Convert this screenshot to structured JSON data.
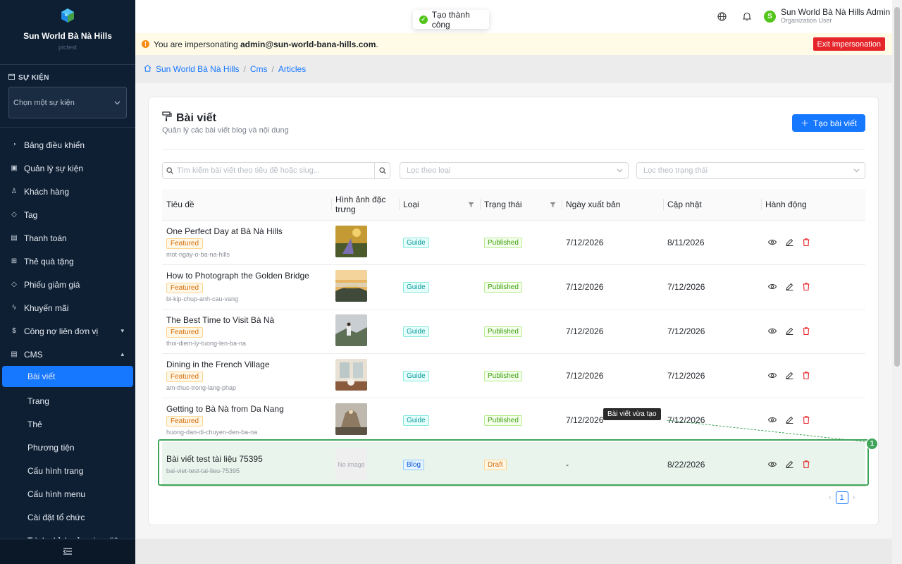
{
  "sidebar": {
    "brand_name": "Sun World Bà Nà Hills",
    "brand_sub": "pictest",
    "section_label": "SỰ KIỆN",
    "event_placeholder": "Chọn một sự kiện",
    "items": [
      {
        "label": "Bảng điều khiển",
        "icon": "dashboard-icon"
      },
      {
        "label": "Quản lý sự kiện",
        "icon": "calendar-icon"
      },
      {
        "label": "Khách hàng",
        "icon": "users-icon"
      },
      {
        "label": "Tag",
        "icon": "tag-icon"
      },
      {
        "label": "Thanh toán",
        "icon": "payment-icon"
      },
      {
        "label": "Thẻ quà tặng",
        "icon": "gift-icon"
      },
      {
        "label": "Phiếu giảm giá",
        "icon": "coupon-icon"
      },
      {
        "label": "Khuyến mãi",
        "icon": "promotion-icon"
      },
      {
        "label": "Công nợ liên đơn vị",
        "icon": "debt-icon"
      },
      {
        "label": "CMS",
        "icon": "cms-icon"
      }
    ],
    "cms_sub": [
      "Bài viết",
      "Trang",
      "Thẻ",
      "Phương tiện",
      "Cấu hình trang",
      "Cấu hình menu",
      "Cài đặt tổ chức",
      "Trình chỉnh sửa giao diện"
    ]
  },
  "toast": "Tạo thành công",
  "user": {
    "name": "Sun World Bà Nà Hills Admin",
    "role": "Organization User",
    "initial": "S"
  },
  "banner": {
    "prefix": "You are impersonating ",
    "email": "admin@sun-world-bana-hills.com",
    "suffix": ".",
    "exit_label": "Exit impersonation"
  },
  "breadcrumb": [
    "Sun World Bà Nà Hills",
    "Cms",
    "Articles"
  ],
  "page": {
    "title": "Bài viết",
    "subtitle": "Quản lý các bài viết blog và nội dung",
    "create_label": "Tạo bài viết",
    "search_placeholder": "Tìm kiếm bài viết theo tiêu đề hoặc slug...",
    "filter_type_placeholder": "Lọc theo loại",
    "filter_status_placeholder": "Lọc theo trạng thái"
  },
  "table": {
    "headers": [
      "Tiêu đề",
      "Hình ảnh đặc trưng",
      "Loại",
      "Trạng thái",
      "Ngày xuất bản",
      "Cập nhật",
      "Hành động"
    ],
    "rows": [
      {
        "title": "One Perfect Day at Bà Nà Hills",
        "featured": "Featured",
        "slug": "mot-ngay-o-ba-na-hills",
        "type": "Guide",
        "status": "Published",
        "published": "7/12/2026",
        "updated": "8/11/2026"
      },
      {
        "title": "How to Photograph the Golden Bridge",
        "featured": "Featured",
        "slug": "bi-kip-chup-anh-cau-vang",
        "type": "Guide",
        "status": "Published",
        "published": "7/12/2026",
        "updated": "7/12/2026"
      },
      {
        "title": "The Best Time to Visit Bà Nà",
        "featured": "Featured",
        "slug": "thoi-diem-ly-tuong-len-ba-na",
        "type": "Guide",
        "status": "Published",
        "published": "7/12/2026",
        "updated": "7/12/2026"
      },
      {
        "title": "Dining in the French Village",
        "featured": "Featured",
        "slug": "am-thuc-trong-lang-phap",
        "type": "Guide",
        "status": "Published",
        "published": "7/12/2026",
        "updated": "7/12/2026"
      },
      {
        "title": "Getting to Bà Nà from Da Nang",
        "featured": "Featured",
        "slug": "huong-dan-di-chuyen-den-ba-na",
        "type": "Guide",
        "status": "Published",
        "published": "7/12/2026",
        "updated": "7/12/2026"
      },
      {
        "title": "Bài viết test tài liệu 75395",
        "featured": "",
        "slug": "bai-viet-test-tai-lieu-75395",
        "type": "Blog",
        "status": "Draft",
        "published": "-",
        "updated": "8/22/2026",
        "no_image": "No image"
      }
    ]
  },
  "annotation": {
    "tooltip": "Bài viết vừa tạo",
    "number": "1"
  },
  "pagination": {
    "current": "1"
  }
}
